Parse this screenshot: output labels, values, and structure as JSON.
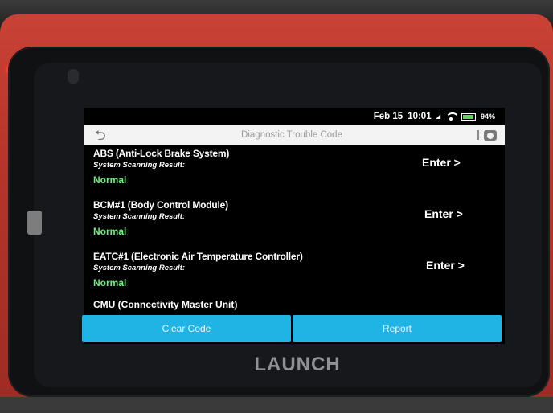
{
  "status": {
    "date": "Feb 15",
    "time": "10:01",
    "network": "◢",
    "battery": "94%"
  },
  "header": {
    "title": "Diagnostic Trouble Code"
  },
  "systems": [
    {
      "name": "ABS (Anti-Lock Brake System)",
      "result_label": "System Scanning Result:",
      "status": "Normal",
      "action": "Enter >"
    },
    {
      "name": "BCM#1 (Body Control Module)",
      "result_label": "System Scanning Result:",
      "status": "Normal",
      "action": "Enter >"
    },
    {
      "name": "EATC#1 (Electronic Air Temperature Controller)",
      "result_label": "System Scanning Result:",
      "status": "Normal",
      "action": "Enter >"
    },
    {
      "name": "CMU (Connectivity Master Unit)"
    }
  ],
  "actions": {
    "clear_code": "Clear Code",
    "report": "Report"
  },
  "device": {
    "brand": "LAUNCH"
  },
  "colors": {
    "accent": "#1fb4e4",
    "normal": "#6ef07a",
    "case": "#c94236"
  }
}
